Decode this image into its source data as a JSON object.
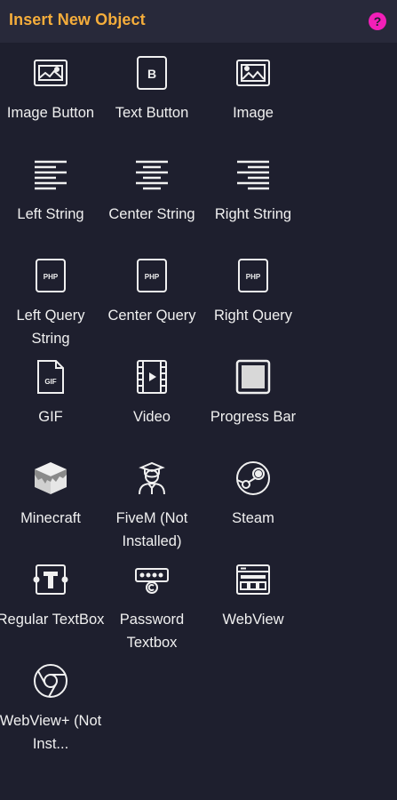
{
  "header": {
    "title": "Insert New Object",
    "help_label": "?"
  },
  "items": [
    {
      "label": "Image Button",
      "icon": "image-button-icon"
    },
    {
      "label": "Text Button",
      "icon": "text-button-icon"
    },
    {
      "label": "Image",
      "icon": "image-icon"
    },
    {
      "label": "Left String",
      "icon": "align-left-icon"
    },
    {
      "label": "Center String",
      "icon": "align-center-icon"
    },
    {
      "label": "Right String",
      "icon": "align-right-icon"
    },
    {
      "label": "Left Query String",
      "icon": "php-file-icon"
    },
    {
      "label": "Center Query",
      "icon": "php-file-icon"
    },
    {
      "label": "Right Query",
      "icon": "php-file-icon"
    },
    {
      "label": "GIF",
      "icon": "gif-file-icon"
    },
    {
      "label": "Video",
      "icon": "video-icon"
    },
    {
      "label": "Progress Bar",
      "icon": "progress-bar-icon"
    },
    {
      "label": "Minecraft",
      "icon": "minecraft-icon"
    },
    {
      "label": "FiveM (Not Installed)",
      "icon": "fivem-icon"
    },
    {
      "label": "Steam",
      "icon": "steam-icon"
    },
    {
      "label": "Regular TextBox",
      "icon": "textbox-icon"
    },
    {
      "label": "Password Textbox",
      "icon": "password-textbox-icon"
    },
    {
      "label": "WebView",
      "icon": "webview-icon"
    },
    {
      "label": "WebView+ (Not Inst...",
      "icon": "chrome-icon"
    }
  ],
  "colors": {
    "background": "#1e1f2e",
    "header_bg": "#28293a",
    "title": "#f5ad3b",
    "help": "#f21fb8",
    "text": "#f0f0f0"
  }
}
